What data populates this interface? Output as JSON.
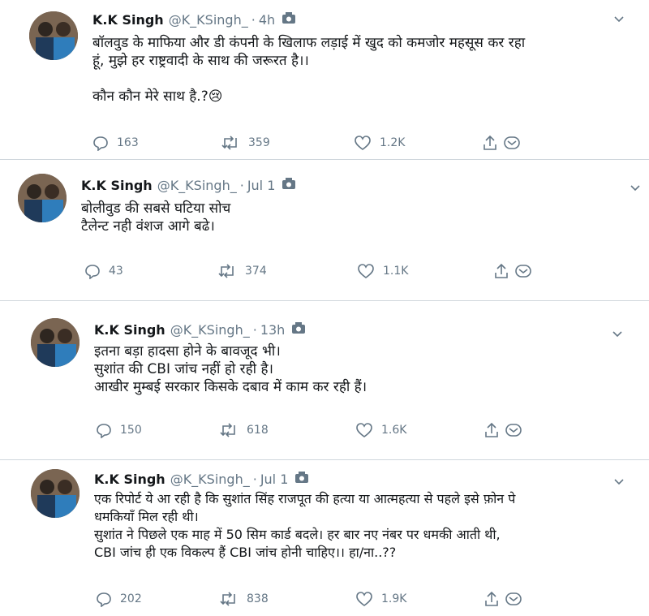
{
  "tweets": [
    {
      "name": "K.K Singh",
      "handle": "@K_KSingh_",
      "time": "4h",
      "text": [
        "बॉलवुड के माफिया और डी कंपनी के खिलाफ लड़ाई में खुद को कमजोर महसूस कर रहा",
        "हूं, मुझे हर राष्ट्रवादी के साथ की जरूरत है।।",
        "",
        "कौन कौन मेरे साथ है.?😢"
      ],
      "replies": "163",
      "retweets": "359",
      "likes": "1.2K"
    },
    {
      "name": "K.K Singh",
      "handle": "@K_KSingh_",
      "time": "Jul 1",
      "text": [
        "बोलीवुड की सबसे घटिया सोच",
        "टैलेन्ट नही वंशज आगे बढे।"
      ],
      "replies": "43",
      "retweets": "374",
      "likes": "1.1K"
    },
    {
      "name": "K.K Singh",
      "handle": "@K_KSingh_",
      "time": "13h",
      "text": [
        "इतना बड़ा हादसा होने के बावजूद भी।",
        "सुशांत की CBI जांच नहीं हो रही है।",
        "आखीर मुम्बई सरकार किसके दबाव में काम कर रही हैं।"
      ],
      "replies": "150",
      "retweets": "618",
      "likes": "1.6K"
    },
    {
      "name": "K.K Singh",
      "handle": "@K_KSingh_",
      "time": "Jul 1",
      "text": [
        "एक रिपोर्ट ये आ रही है कि सुशांत सिंह राजपूत की हत्या या आत्महत्या से पहले इसे फ़ोन पे",
        "धमकियाँ मिल रही थी।",
        "सुशांत ने पिछले एक माह में 50 सिम कार्ड बदले। हर बार नए नंबर पर धमकी आती थी,",
        "CBI जांच ही एक विकल्प हैं CBI जांच होनी चाहिए।। हा/ना..??"
      ],
      "replies": "202",
      "retweets": "838",
      "likes": "1.9K"
    }
  ],
  "colors": {
    "text": "#14171a",
    "muted": "#657786",
    "separator": "#cfd6dc"
  },
  "icons": {
    "reply": "reply-icon",
    "retweet": "retweet-icon",
    "like": "heart-icon",
    "share": "share-icon",
    "dm": "direct-message-icon",
    "camera": "camera-icon",
    "menu": "chevron-down-icon"
  }
}
